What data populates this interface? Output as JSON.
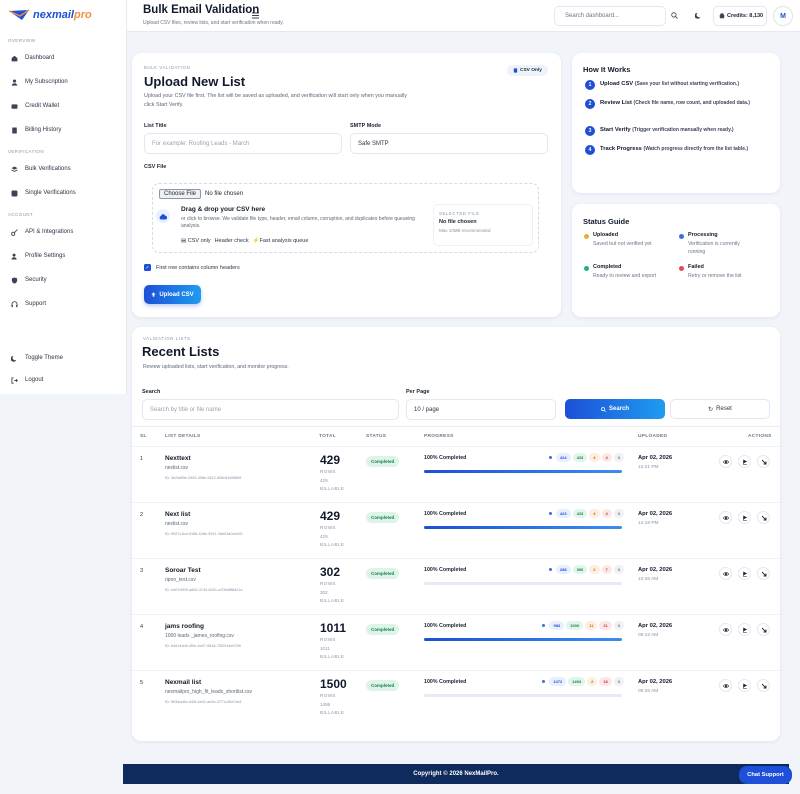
{
  "brand": {
    "part1": "nexmail",
    "part2": "pro"
  },
  "sidebar": {
    "sections": [
      "OVERVIEW",
      "VERIFICATION",
      "ACCOUNT"
    ],
    "items": [
      {
        "label": "Dashboard",
        "icon": "home-icon"
      },
      {
        "label": "My Subscription",
        "icon": "user-icon"
      },
      {
        "label": "Credit Wallet",
        "icon": "wallet-icon"
      },
      {
        "label": "Billing History",
        "icon": "receipt-icon"
      },
      {
        "label": "Bulk Verifications",
        "icon": "layers-icon"
      },
      {
        "label": "Single Verifications",
        "icon": "check-icon"
      },
      {
        "label": "API & Integrations",
        "icon": "key-icon"
      },
      {
        "label": "Profile Settings",
        "icon": "user-cog-icon"
      },
      {
        "label": "Security",
        "icon": "shield-icon"
      },
      {
        "label": "Support",
        "icon": "headset-icon"
      }
    ],
    "bottom": [
      {
        "label": "Toggle Theme",
        "icon": "moon-icon"
      },
      {
        "label": "Logout",
        "icon": "logout-icon"
      }
    ]
  },
  "header": {
    "title": "Bulk Email Validation",
    "subtitle": "Upload CSV files, review lists, and start verification when ready.",
    "search_placeholder": "Search dashboard...",
    "credits": "Credits: 8,130",
    "avatar": "M"
  },
  "upload": {
    "kicker": "BULK VALIDATION",
    "badge": "CSV Only",
    "title": "Upload New List",
    "desc": "Upload your CSV file first. The list will be saved as uploaded, and verification will start only when you manually click Start Verify.",
    "list_title_label": "List Title",
    "list_title_placeholder": "For example: Roofing Leads - March",
    "smtp_label": "SMTP Mode",
    "smtp_value": "Safe SMTP",
    "csv_label": "CSV File",
    "choose_button": "Choose File",
    "no_file": "No file chosen",
    "drop_title": "Drag & drop your CSV here",
    "drop_desc": "or click to browse. We validate file type, header, email column, corruption, and duplicates before queueing analysis.",
    "chip1": "CSV only",
    "chip2": "Header check",
    "chip3": "Fast analysis queue",
    "selected_label": "SELECTED FILE",
    "selected_value": "No file chosen",
    "selected_note": "Max 10MB recommended",
    "checkbox_label": "First row contains column headers",
    "upload_button": "Upload CSV"
  },
  "how": {
    "title": "How It Works",
    "steps": [
      {
        "n": "1",
        "title": "Upload CSV",
        "desc": "(Save your list without starting verification.)"
      },
      {
        "n": "2",
        "title": "Review List",
        "desc": "(Check file name, row count, and uploaded data.)"
      },
      {
        "n": "3",
        "title": "Start Verify",
        "desc": "(Trigger verification manually when ready.)"
      },
      {
        "n": "4",
        "title": "Track Progress",
        "desc": "(Watch progress directly from the list table.)"
      }
    ]
  },
  "status_guide": {
    "title": "Status Guide",
    "items": [
      {
        "title": "Uploaded",
        "desc": "Saved but not verified yet",
        "color": "#f2a93b"
      },
      {
        "title": "Processing",
        "desc": "Verification is currently running",
        "color": "#3b6fe0"
      },
      {
        "title": "Completed",
        "desc": "Ready to review and export",
        "color": "#22b07d"
      },
      {
        "title": "Failed",
        "desc": "Retry or remove the list",
        "color": "#e5484d"
      }
    ]
  },
  "recent": {
    "kicker": "VALIDATION LISTS",
    "title": "Recent Lists",
    "desc": "Review uploaded lists, start verification, and monitor progress.",
    "search_label": "Search",
    "search_placeholder": "Search by title or file name",
    "per_page_label": "Per Page",
    "per_page_value": "10 / page",
    "search_button": "Search",
    "reset_button": "Reset",
    "columns": [
      "SL",
      "LIST DETAILS",
      "TOTAL",
      "STATUS",
      "PROGRESS",
      "UPLOADED",
      "ACTIONS"
    ],
    "rows_label": "ROWS",
    "billable_label": "BILLABLE",
    "rows": [
      {
        "sl": "1",
        "name": "Nexttext",
        "file": "nexlist.csv",
        "id": "ID: 3b2a8f9e-2953-498e-9612-808d1f408669",
        "total": "429",
        "billable": "429",
        "status": "Completed",
        "progress": "100% Completed",
        "progress_pct": 100,
        "counts": [
          "424",
          "423",
          "4",
          "4",
          "0"
        ],
        "date": "Apr 02, 2026",
        "time": "12:21 PM"
      },
      {
        "sl": "2",
        "name": "Next list",
        "file": "nexlist.csv",
        "id": "ID: 9927c1bd-9188-448e-9911-3ab03a0a4e01",
        "total": "429",
        "billable": "429",
        "status": "Completed",
        "progress": "100% Completed",
        "progress_pct": 100,
        "counts": [
          "423",
          "423",
          "4",
          "4",
          "0"
        ],
        "date": "Apr 02, 2026",
        "time": "12:18 PM"
      },
      {
        "sl": "3",
        "name": "Soroar Test",
        "file": "ripon_test.csv",
        "id": "ID: ea07d909-ad52-4744-8401-a706d8f8d21d",
        "total": "302",
        "billable": "302",
        "status": "Completed",
        "progress": "100% Completed",
        "progress_pct": 0,
        "counts": [
          "288",
          "300",
          "2",
          "7",
          "0"
        ],
        "date": "Apr 02, 2026",
        "time": "10:26 AM"
      },
      {
        "sl": "4",
        "name": "jams roofing",
        "file": "1000 leads _james_roofing.csv",
        "id": "ID: 64d14cb8-4f0e-4c67-9818-7f52918e0780",
        "total": "1011",
        "billable": "1011",
        "status": "Completed",
        "progress": "100% Completed",
        "progress_pct": 100,
        "counts": [
          "983",
          "1000",
          "11",
          "21",
          "0"
        ],
        "date": "Apr 02, 2026",
        "time": "09:42 AM"
      },
      {
        "sl": "5",
        "name": "Nexmail list",
        "file": "nexmailpro_high_fit_leads_shortlist.csv",
        "id": "ID: 5634ad6c-d44f-4e01-ac0a-3771c26d7ae1",
        "total": "1500",
        "billable": "1486",
        "status": "Completed",
        "progress": "100% Completed",
        "progress_pct": 0,
        "counts": [
          "1472",
          "1494",
          "2",
          "18",
          "0"
        ],
        "date": "Apr 02, 2026",
        "time": "09:26 AM"
      }
    ]
  },
  "footer": {
    "copyright": "Copyright © 2026 NexMailPro.",
    "chat": "Chat Support"
  },
  "colors": {
    "primary": "#1d4fd8",
    "accent": "#f2913a",
    "footer": "#0f2a5c"
  }
}
